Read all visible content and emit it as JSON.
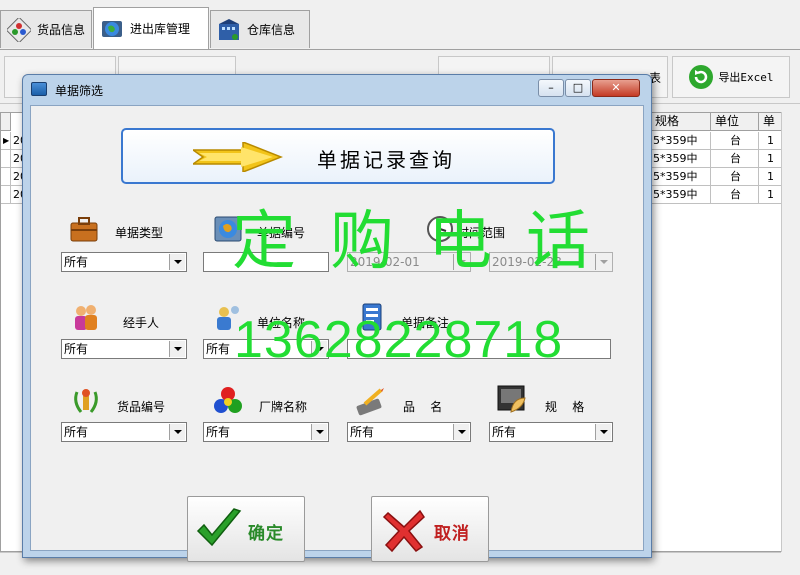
{
  "main_window": {
    "tabs": [
      {
        "label": "货品信息",
        "icon": "goods-icon"
      },
      {
        "label": "进出库管理",
        "icon": "globe-icon"
      },
      {
        "label": "仓库信息",
        "icon": "warehouse-icon"
      }
    ],
    "toolbar": {
      "partial_label": "表",
      "export_label": "导出Excel"
    },
    "grid": {
      "headers": [
        "规格",
        "单位",
        "单"
      ],
      "rows": [
        {
          "pre": "20",
          "spec": "5*359中",
          "unit": "台",
          "qty": "1"
        },
        {
          "pre": "20",
          "spec": "5*359中",
          "unit": "台",
          "qty": "1"
        },
        {
          "pre": "20",
          "spec": "5*359中",
          "unit": "台",
          "qty": "1"
        },
        {
          "pre": "20",
          "spec": "5*359中",
          "unit": "台",
          "qty": "1"
        }
      ]
    }
  },
  "dialog": {
    "title": "单据筛选",
    "window_buttons": {
      "minimize": "–",
      "maximize": "□",
      "close": "✕"
    },
    "banner": {
      "text": "单据记录查询"
    },
    "fields": {
      "doc_type": {
        "label": "单据类型",
        "value": "所有"
      },
      "doc_no": {
        "label": "单据编号",
        "value": ""
      },
      "date_range": {
        "label": "时间范围",
        "from": "2019-02-01",
        "to": "2019-02-28"
      },
      "handler": {
        "label": "经手人",
        "value": "所有"
      },
      "company": {
        "label": "单位名称",
        "value": "所有"
      },
      "doc_note": {
        "label": "单据备注",
        "value": ""
      },
      "item_no": {
        "label": "货品编号",
        "value": "所有"
      },
      "brand": {
        "label": "厂牌名称",
        "value": "所有"
      },
      "product": {
        "label": "品    名",
        "value": "所有"
      },
      "spec": {
        "label": "规    格",
        "value": "所有"
      }
    },
    "buttons": {
      "ok": "确定",
      "cancel": "取消"
    }
  },
  "watermark": {
    "words": "定购电话",
    "phone": "13628228718"
  },
  "colors": {
    "watermark": "#22dd33",
    "dialog_frame": "#bcd3ea",
    "banner_border": "#3a78d0"
  }
}
